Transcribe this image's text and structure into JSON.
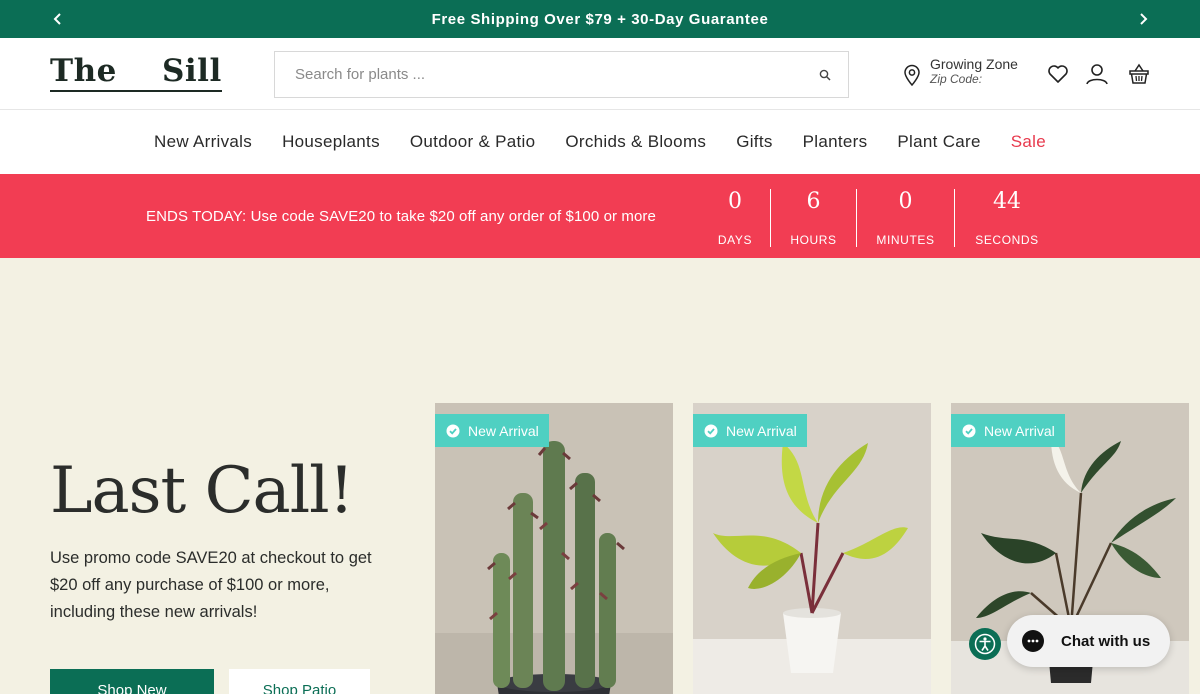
{
  "announcement": {
    "text": "Free Shipping Over $79 + 30-Day Guarantee",
    "prev_icon": "chevron-left-icon",
    "next_icon": "chevron-right-icon"
  },
  "header": {
    "logo_text": "The    Sill",
    "search": {
      "placeholder": "Search for plants ...",
      "value": ""
    },
    "zone": {
      "title": "Growing Zone",
      "subtitle": "Zip Code:"
    },
    "icons": [
      "location-pin-icon",
      "heart-icon",
      "account-icon",
      "cart-icon"
    ]
  },
  "nav": {
    "items": [
      {
        "label": "New Arrivals"
      },
      {
        "label": "Houseplants"
      },
      {
        "label": "Outdoor & Patio"
      },
      {
        "label": "Orchids & Blooms"
      },
      {
        "label": "Gifts"
      },
      {
        "label": "Planters"
      },
      {
        "label": "Plant Care"
      },
      {
        "label": "Sale"
      }
    ]
  },
  "promo": {
    "message": "ENDS TODAY: Use code SAVE20 to take $20 off any order of $100 or more",
    "countdown": [
      {
        "value": "0",
        "label": "Days"
      },
      {
        "value": "6",
        "label": "Hours"
      },
      {
        "value": "0",
        "label": "Minutes"
      },
      {
        "value": "44",
        "label": "Seconds"
      }
    ]
  },
  "hero": {
    "title": "Last Call!",
    "copy": "Use promo code SAVE20 at checkout to get $20 off any purchase of $100 or more, including these new arrivals!",
    "primary_button": "Shop New",
    "secondary_button": "Shop Patio",
    "cards": [
      {
        "badge": "New Arrival"
      },
      {
        "badge": "New Arrival"
      },
      {
        "badge": "New Arrival"
      }
    ]
  },
  "chat": {
    "label": "Chat with us"
  },
  "colors": {
    "brand_green": "#0b6e55",
    "promo_red": "#f23d53",
    "sale_red": "#e8394d",
    "hero_bg": "#f3f1e3",
    "badge_teal": "#4fd0c2"
  }
}
